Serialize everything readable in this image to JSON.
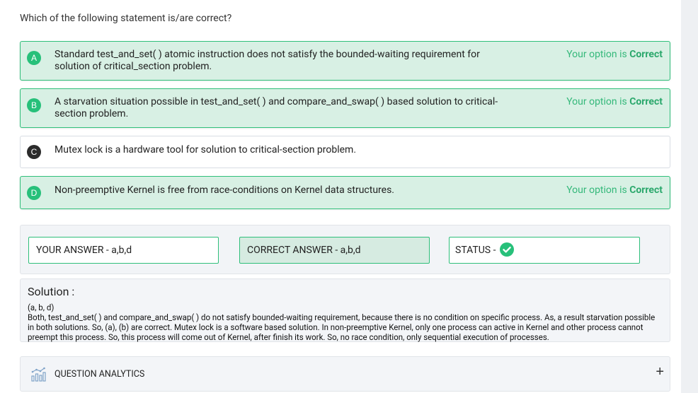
{
  "question": "Which of the following statement is/are correct?",
  "options": [
    {
      "letter": "A",
      "text": "Standard test_and_set( ) atomic instruction does not satisfy the bounded-waiting requirement for solution of critical_section problem.",
      "status_prefix": "Your option is ",
      "status_word": "Correct"
    },
    {
      "letter": "B",
      "text": "A starvation situation possible in test_and_set( ) and compare_and_swap( ) based solution to critical-section problem.",
      "status_prefix": "Your option is ",
      "status_word": "Correct"
    },
    {
      "letter": "C",
      "text": "Mutex lock is a hardware tool for solution to critical-section problem.",
      "status_prefix": "",
      "status_word": ""
    },
    {
      "letter": "D",
      "text": "Non-preemptive Kernel is free from race-conditions on Kernel data structures.",
      "status_prefix": "Your option is ",
      "status_word": "Correct"
    }
  ],
  "answers": {
    "your_answer": "YOUR ANSWER - a,b,d",
    "correct_answer": "CORRECT ANSWER - a,b,d",
    "status_label": "STATUS -",
    "status_icon": "check-circle-icon"
  },
  "solution": {
    "title": "Solution :",
    "line1": "(a, b, d)",
    "body": "Both, test_and_set( ) and compare_and_swap( ) do not satisfy bounded-waiting requirement, because there is no condition on specific process. As, a result starvation possible in both solutions. So, (a), (b) are correct. Mutex lock is a software based solution. In non-preemptive Kernel, only one process can active in Kernel and other process cannot preempt this process. So, this process will come out of Kernel, after finish its work. So, no race condition, only sequential execution of processes."
  },
  "analytics": {
    "label": "QUESTION ANALYTICS",
    "icon": "analytics-chart-icon",
    "expand_symbol": "+"
  },
  "colors": {
    "correct_green": "#27c07a",
    "correct_bg": "#d8f0e4",
    "unselected_badge": "#2b2b2b"
  }
}
